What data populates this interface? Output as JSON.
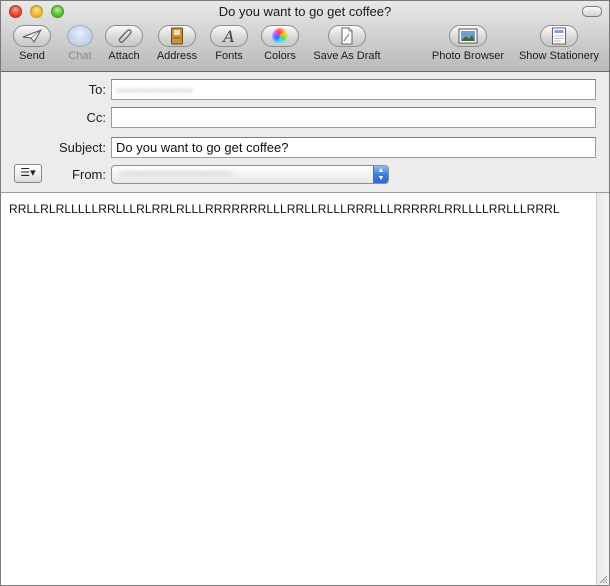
{
  "window": {
    "title": "Do you want to go get coffee?"
  },
  "toolbar": {
    "items": [
      {
        "label": "Send",
        "icon": "paper-plane-icon"
      },
      {
        "label": "Chat",
        "icon": "chat-bubble-icon",
        "disabled": true
      },
      {
        "label": "Attach",
        "icon": "paperclip-icon"
      },
      {
        "label": "Address",
        "icon": "address-book-icon"
      },
      {
        "label": "Fonts",
        "icon": "font-icon"
      },
      {
        "label": "Colors",
        "icon": "color-wheel-icon"
      },
      {
        "label": "Save As Draft",
        "icon": "draft-icon"
      },
      {
        "label": "Photo Browser",
        "icon": "photo-icon"
      },
      {
        "label": "Show Stationery",
        "icon": "stationery-icon"
      }
    ]
  },
  "header": {
    "to_label": "To:",
    "to_value": "••••••••••••••••••••",
    "cc_label": "Cc:",
    "cc_value": "",
    "subject_label": "Subject:",
    "subject_value": "Do you want to go get coffee?",
    "from_label": "From:",
    "from_value": "•••••••••••••••••••••••••••••",
    "account_menu_glyph": "☰▾"
  },
  "message": {
    "body": "RRLLRLRLLLLLRRLLLRLRRLRLLLRRRRRRRLLLRRLLRLLLRRRLLLRRRRRLRRLLLLRRLLLRRRL"
  },
  "colors": {
    "accent_blue": "#3d7fe0",
    "toolbar_top": "#e9e9e9",
    "toolbar_bottom": "#b9b9b9"
  }
}
